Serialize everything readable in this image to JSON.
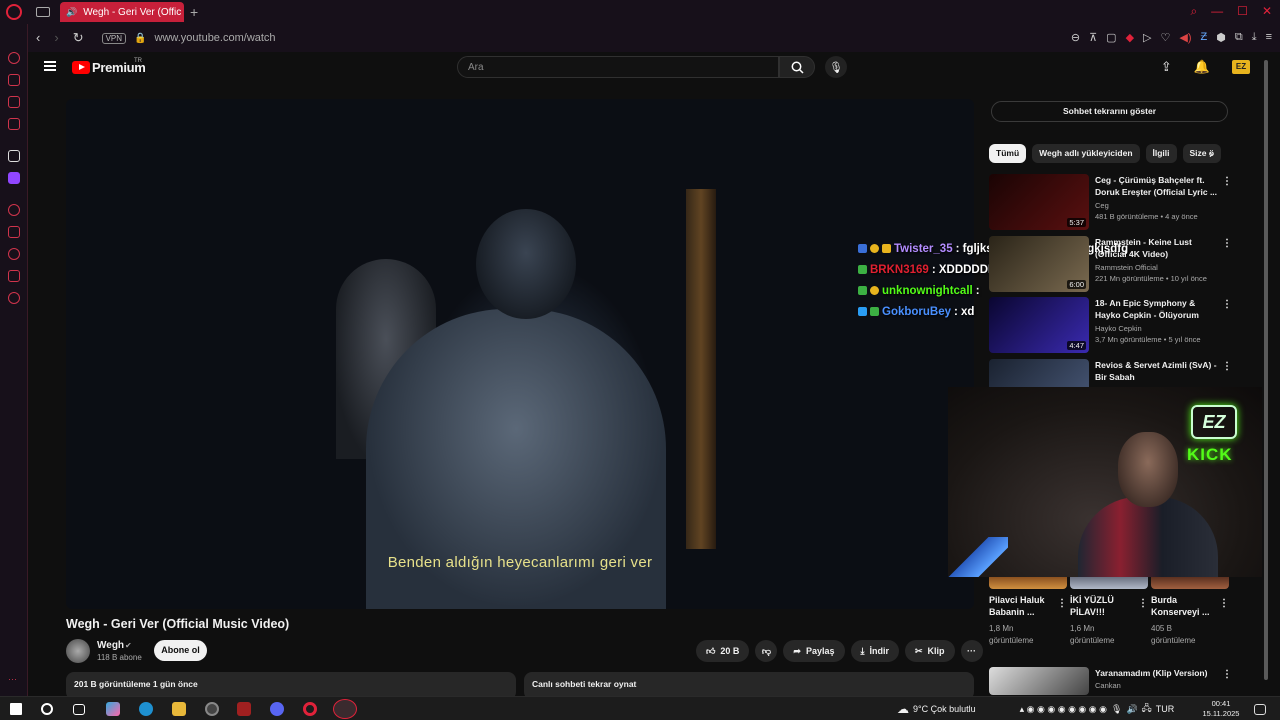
{
  "browser": {
    "tab_title": "Wegh - Geri Ver (Offic",
    "url": "www.youtube.com/watch",
    "vpn_label": "VPN",
    "accent": "#c7203a"
  },
  "header": {
    "brand": "Premium",
    "brand_sup": "TR",
    "search_placeholder": "Ara",
    "avatar_label": "EZ"
  },
  "video": {
    "subtitle": "Benden aldığın heyecanlarımı geri ver",
    "title": "Wegh - Geri Ver (Official Music Video)",
    "channel": "Wegh",
    "subscribers": "118 B abone",
    "subscribe_label": "Abone ol",
    "likes": "20 B",
    "share_label": "Paylaş",
    "download_label": "İndir",
    "clip_label": "Klip",
    "description_meta": "201 B görüntüleme  1 gün önce",
    "chat_replay": "Canlı sohbeti tekrar oynat"
  },
  "overlay_chat": [
    {
      "user": "Twister_35",
      "color": "#b38cff",
      "text": ": fgljksdfklgjsdfslgkjsdflgkjsdfg"
    },
    {
      "user": "BRKN3169",
      "color": "#e02030",
      "text": ": XDDDDDDDDDD"
    },
    {
      "user": "unknownightcall",
      "color": "#53fc18",
      "text": ":"
    },
    {
      "user": "GokboruBey",
      "color": "#4a90ff",
      "text": ": xd"
    }
  ],
  "sidebar": {
    "chat_button": "Sohbet tekrarını göster",
    "chips": [
      "Tümü",
      "Wegh adlı yükleyiciden",
      "İlgili",
      "Size ö"
    ],
    "recommendations": [
      {
        "title": "Ceg - Çürümüş Bahçeler ft. Doruk Ereşter (Official Lyric ...",
        "channel": "Ceg",
        "meta": "481 B görüntüleme • 4 ay önce",
        "duration": "5:37",
        "thumb": "#3a0808"
      },
      {
        "title": "Rammstein - Keine Lust (Official 4K Video)",
        "channel": "Rammstein Official",
        "meta": "221 Mn görüntüleme • 10 yıl önce",
        "duration": "6:00",
        "thumb": "#5a5040"
      },
      {
        "title": "18- An Epic Symphony & Hayko Cepkin - Ölüyorum",
        "channel": "Hayko Cepkin",
        "meta": "3,7 Mn görüntüleme • 5 yıl önce",
        "duration": "4:47",
        "thumb": "#2a1a8a"
      },
      {
        "title": "Revios & Servet Azimli (SvA) - Bir Sabah",
        "channel": "",
        "meta": "",
        "duration": "",
        "thumb": "#3a4a6a"
      }
    ],
    "shorts": [
      {
        "title": "Pilavci Haluk Babanin ...",
        "views": "1,8 Mn görüntüleme"
      },
      {
        "title": "İKİ YÜZLÜ PİLAV!!!",
        "views": "1,6 Mn görüntüleme"
      },
      {
        "title": "Burda Konserveyi ...",
        "views": "405 B görüntüleme"
      }
    ],
    "last_rec": {
      "title": "Yaranamadım (Klip Version)",
      "channel": "Cankan"
    },
    "webcam": {
      "logo_top": "EZ",
      "logo_bottom": "KICK"
    }
  },
  "taskbar": {
    "weather": "9°C  Çok bulutlu",
    "lang": "TUR",
    "time": "00:41",
    "date": "15.11.2025"
  }
}
